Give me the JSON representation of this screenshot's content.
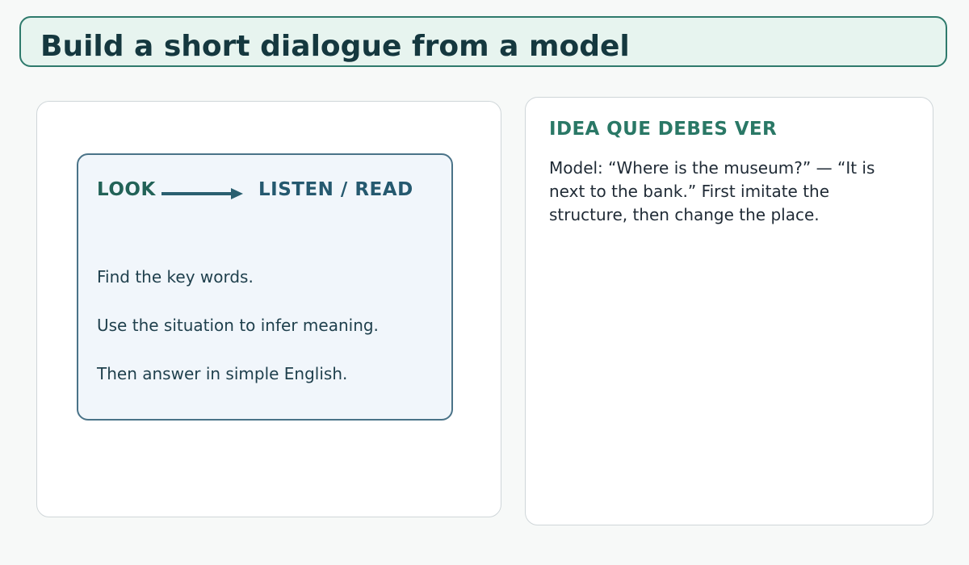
{
  "title": "Build a short dialogue from a model",
  "flow": {
    "from_label": "LOOK",
    "to_label": "LISTEN / READ",
    "steps": [
      "Find the key words.",
      "Use the situation to infer meaning.",
      "Then answer in simple English."
    ]
  },
  "idea": {
    "heading": "IDEA QUE DEBES VER",
    "body": "Model: “Where is the museum?” — “It is next to the bank.” First imitate the structure, then change the place."
  },
  "colors": {
    "title_border": "#2e7a6c",
    "title_background": "#e7f4ef",
    "title_text": "#15383f",
    "flow_border": "#4a7388",
    "flow_background": "#f1f6fb",
    "look_label": "#226257",
    "listen_label": "#25596f",
    "arrow": "#2a5f70",
    "idea_heading": "#2a7866"
  }
}
